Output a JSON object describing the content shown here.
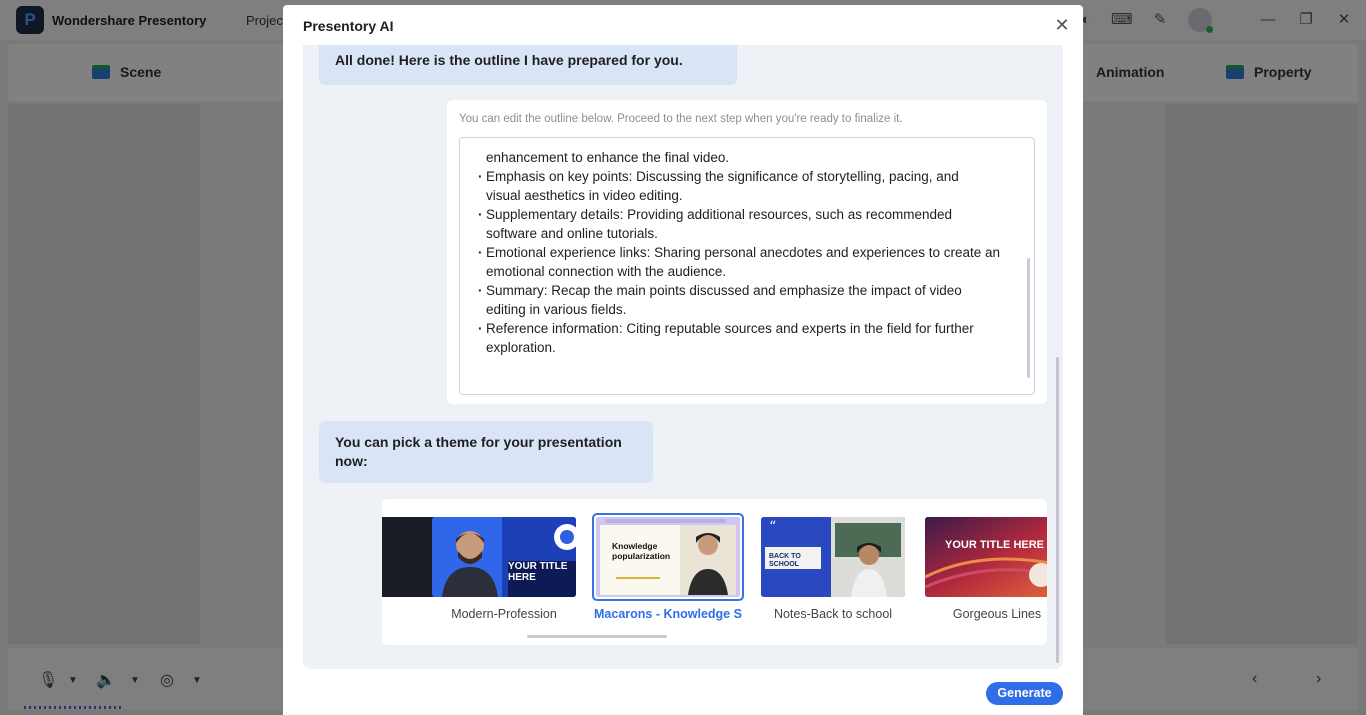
{
  "app": {
    "name": "Wondershare Presentory",
    "project_tab": "Project",
    "toolbar": {
      "scene": "Scene",
      "animation": "Animation",
      "property": "Property"
    }
  },
  "modal": {
    "title": "Presentory AI",
    "messages": {
      "done": "All done! Here is the outline I have prepared for you.",
      "pick_theme_line1": "You can pick a theme for your presentation",
      "pick_theme_line2": "now:"
    },
    "outline": {
      "hint": "You can edit the outline below. Proceed to the next step when you're ready to finalize it.",
      "lines": [
        {
          "text": "enhancement to enhance the final video.",
          "bullet": false
        },
        {
          "text": "Emphasis on key points: Discussing the significance of storytelling, pacing, and",
          "bullet": true
        },
        {
          "text": "visual aesthetics in video editing.",
          "bullet": false
        },
        {
          "text": "Supplementary details: Providing additional resources, such as recommended",
          "bullet": true
        },
        {
          "text": "software and online tutorials.",
          "bullet": false
        },
        {
          "text": "Emotional experience links: Sharing personal anecdotes and experiences to create an",
          "bullet": true
        },
        {
          "text": "emotional connection with the audience.",
          "bullet": false
        },
        {
          "text": "Summary: Recap the main points discussed and emphasize the impact of video",
          "bullet": true
        },
        {
          "text": "editing in various fields.",
          "bullet": false
        },
        {
          "text": "Reference information: Citing reputable sources and experts in the field for further",
          "bullet": true
        },
        {
          "text": "exploration.",
          "bullet": false
        }
      ]
    },
    "themes": [
      {
        "label": "",
        "selected": false
      },
      {
        "label": "Modern-Profession",
        "thumb_text": "YOUR TITLE HERE",
        "selected": false
      },
      {
        "label": "Macarons - Knowledge S...",
        "thumb_text": "Knowledge popularization",
        "selected": true
      },
      {
        "label": "Notes-Back to school",
        "thumb_text": "BACK TO SCHOOL",
        "selected": false
      },
      {
        "label": "Gorgeous Lines",
        "thumb_text": "YOUR TITLE HERE",
        "selected": false
      }
    ],
    "generate_label": "Generate"
  },
  "colors": {
    "accent": "#2f6ee6",
    "bubble": "#d9e5f7",
    "chat_bg": "#eef1f6"
  }
}
